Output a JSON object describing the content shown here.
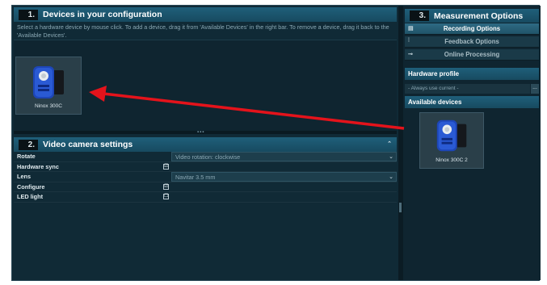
{
  "config_panel": {
    "number": "1.",
    "title": "Devices in your configuration",
    "hint": "Select a hardware device by mouse click. To add a device, drag it from 'Available Devices' in the right bar. To remove a device, drag it back to the 'Available Devices'.",
    "devices": [
      {
        "label": "Ninox 300C",
        "icon": "camera-icon"
      }
    ]
  },
  "camera_panel": {
    "number": "2.",
    "title": "Video camera settings",
    "collapse_icon": "chevron-up-icon",
    "rows": [
      {
        "key": "Rotate",
        "value": "Video rotation: clockwise",
        "checked": null
      },
      {
        "key": "Hardware sync",
        "value": "",
        "checked": "☑"
      },
      {
        "key": "Lens",
        "value": "Navitar 3.5 mm",
        "checked": null
      },
      {
        "key": "Configure",
        "value": "",
        "checked": "☑"
      },
      {
        "key": "LED light",
        "value": "",
        "checked": "☐"
      }
    ]
  },
  "right_panel": {
    "number": "3.",
    "title": "Measurement Options",
    "menu": [
      {
        "label": "Recording Options",
        "icon": "recording-icon",
        "active": true
      },
      {
        "label": "Feedback Options",
        "icon": "feedback-icon",
        "active": false
      },
      {
        "label": "Online Processing",
        "icon": "processing-icon",
        "active": false
      }
    ],
    "hardware_profile": {
      "title": "Hardware profile",
      "value": "- Always use current -",
      "button": "..."
    },
    "available_devices": {
      "title": "Available devices",
      "devices": [
        {
          "label": "Ninox 300C 2",
          "icon": "camera-icon"
        }
      ]
    }
  },
  "colors": {
    "background": "#102a36",
    "header": "#1f5f7a",
    "arrow": "#e4131b",
    "camera_blue": "#1d46b8"
  }
}
